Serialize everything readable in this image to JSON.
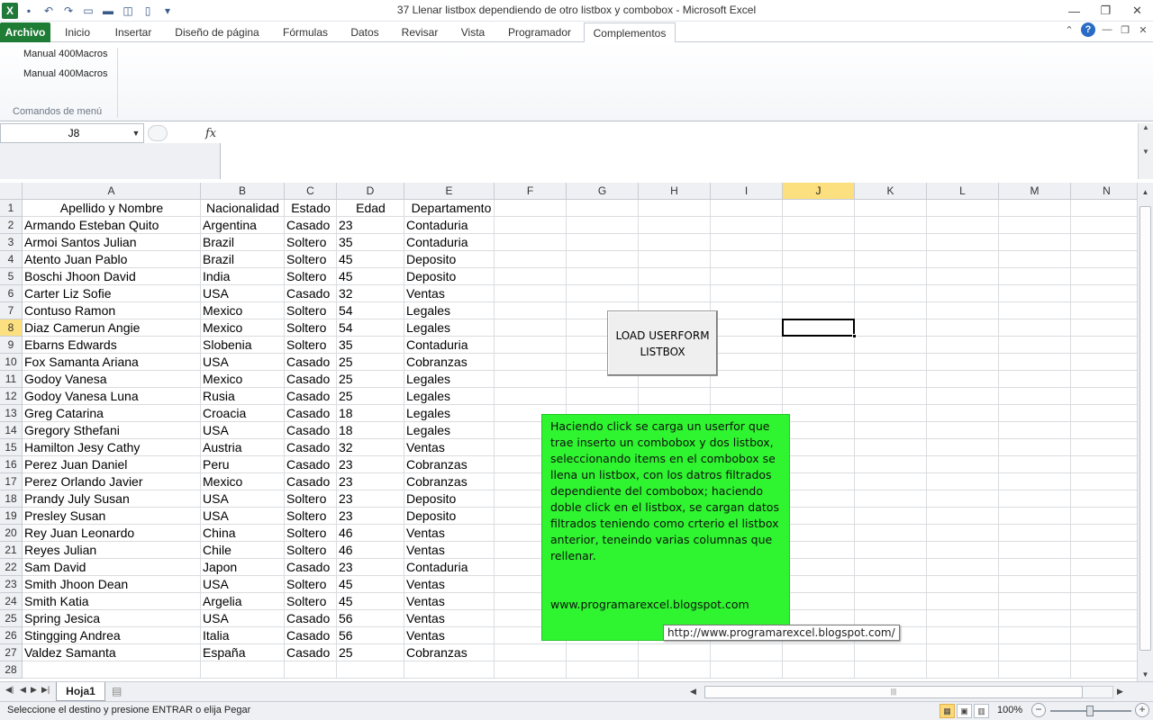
{
  "window": {
    "title": "37 Llenar listbox dependiendo de otro listbox y combobox  -  Microsoft Excel",
    "app_icon": "excel-icon"
  },
  "tabs": {
    "file": "Archivo",
    "items": [
      "Inicio",
      "Insertar",
      "Diseño de página",
      "Fórmulas",
      "Datos",
      "Revisar",
      "Vista",
      "Programador",
      "Complementos"
    ],
    "active": "Complementos"
  },
  "ribbon": {
    "item1": "Manual 400Macros",
    "item2": "Manual 400Macros",
    "group_label": "Comandos de menú"
  },
  "formula_bar": {
    "name_box": "J8",
    "fx": "fx",
    "formula": ""
  },
  "grid": {
    "columns": [
      "A",
      "B",
      "C",
      "D",
      "E",
      "F",
      "G",
      "H",
      "I",
      "J",
      "K",
      "L",
      "M",
      "N"
    ],
    "selected_column": "J",
    "selected_row": 8,
    "row_count": 28,
    "header_row": [
      "Apellido y Nombre",
      "Nacionalidad",
      "Estado",
      "Edad",
      "Departamento"
    ],
    "rows": [
      [
        "Armando Esteban Quito",
        "Argentina",
        "Casado",
        "23",
        "Contaduria"
      ],
      [
        "Armoi Santos Julian",
        "Brazil",
        "Soltero",
        "35",
        "Contaduria"
      ],
      [
        "Atento Juan Pablo",
        "Brazil",
        "Soltero",
        "45",
        "Deposito"
      ],
      [
        "Boschi Jhoon David",
        "India",
        "Soltero",
        "45",
        "Deposito"
      ],
      [
        "Carter Liz Sofie",
        "USA",
        "Casado",
        "32",
        "Ventas"
      ],
      [
        "Contuso Ramon",
        "Mexico",
        "Soltero",
        "54",
        "Legales"
      ],
      [
        "Diaz Camerun Angie",
        "Mexico",
        "Soltero",
        "54",
        "Legales"
      ],
      [
        "Ebarns Edwards",
        "Slobenia",
        "Soltero",
        "35",
        "Contaduria"
      ],
      [
        "Fox Samanta Ariana",
        "USA",
        "Casado",
        "25",
        "Cobranzas"
      ],
      [
        "Godoy Vanesa",
        "Mexico",
        "Casado",
        "25",
        "Legales"
      ],
      [
        "Godoy Vanesa Luna",
        "Rusia",
        "Casado",
        "25",
        "Legales"
      ],
      [
        "Greg Catarina",
        "Croacia",
        "Casado",
        "18",
        "Legales"
      ],
      [
        "Gregory Sthefani",
        "USA",
        "Casado",
        "18",
        "Legales"
      ],
      [
        "Hamilton Jesy Cathy",
        "Austria",
        "Casado",
        "32",
        "Ventas"
      ],
      [
        "Perez Juan Daniel",
        "Peru",
        "Casado",
        "23",
        "Cobranzas"
      ],
      [
        "Perez Orlando Javier",
        "Mexico",
        "Casado",
        "23",
        "Cobranzas"
      ],
      [
        "Prandy July Susan",
        "USA",
        "Soltero",
        "23",
        "Deposito"
      ],
      [
        "Presley  Susan",
        "USA",
        "Soltero",
        "23",
        "Deposito"
      ],
      [
        "Rey Juan Leonardo",
        "China",
        "Soltero",
        "46",
        "Ventas"
      ],
      [
        "Reyes Julian",
        "Chile",
        "Soltero",
        "46",
        "Ventas"
      ],
      [
        "Sam David",
        "Japon",
        "Casado",
        "23",
        "Contaduria"
      ],
      [
        "Smith Jhoon Dean",
        "USA",
        "Soltero",
        "45",
        "Ventas"
      ],
      [
        "Smith Katia",
        "Argelia",
        "Soltero",
        "45",
        "Ventas"
      ],
      [
        "Spring Jesica",
        "USA",
        "Casado",
        "56",
        "Ventas"
      ],
      [
        "Stingging Andrea",
        "Italia",
        "Casado",
        "56",
        "Ventas"
      ],
      [
        "Valdez Samanta",
        "España",
        "Casado",
        "25",
        "Cobranzas"
      ]
    ]
  },
  "button": {
    "line1": "LOAD USERFORM",
    "line2": "LISTBOX"
  },
  "note": {
    "text": "Haciendo click se carga  un userfor que trae  inserto un combobox y dos  listbox, seleccionando items  en el combobox se llena un  listbox, con los datros  filtrados dependiente del combobox; haciendo doble  click en el listbox, se cargan datos filtrados  teniendo como crterio el listbox anterior, teneindo varias columnas que rellenar.",
    "url": "www.programarexcel.blogspot.com"
  },
  "tooltip": "http://www.programarexcel.blogspot.com/",
  "sheets": {
    "active": "Hoja1"
  },
  "status": {
    "text": "Seleccione el destino y presione ENTRAR o elija Pegar",
    "zoom": "100%"
  }
}
